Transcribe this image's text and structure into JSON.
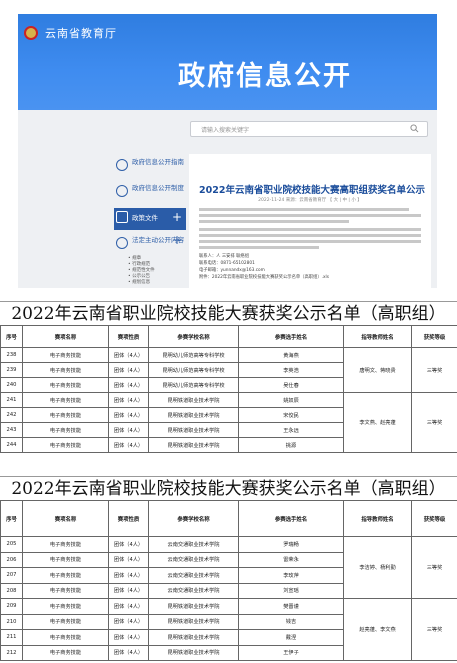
{
  "site": {
    "name": "云南省教育厅",
    "banner_title": "政府信息公开"
  },
  "search": {
    "placeholder": "请输入搜索关键字"
  },
  "sidebar": {
    "items": [
      {
        "label": "政府信息公开指南"
      },
      {
        "label": "政府信息公开制度"
      },
      {
        "label": "政策文件"
      },
      {
        "label": "法定主动公开内容"
      }
    ],
    "sub_items": [
      "• 规章",
      "• 行政规范",
      "• 规范性文件",
      "• 公示公告",
      "• 规划信息"
    ]
  },
  "article": {
    "title": "2022年云南省职业院校技能大赛高职组获奖名单公示",
    "meta": "2022-11-24  来源：云南省教育厅  【 大 | 中 | 小 】",
    "footer_lines": [
      "联系人：人 三安排 联络组",
      "联系电话：0871-65102801",
      "电子邮箱：yunnandx@163.com",
      "附件：2022年云南省职业院校技能大赛获奖公示名单（高职组）.xls"
    ]
  },
  "table1": {
    "title": "2022年云南省职业院校技能大赛获奖公示名单（高职组）",
    "headers": [
      "序号",
      "赛项名称",
      "赛项性质",
      "参赛学校名称",
      "参赛选手姓名",
      "指导教师姓名",
      "获奖等级"
    ],
    "rows": [
      {
        "no": "238",
        "event": "电子商务技能",
        "type": "团体（4人）",
        "school": "昆明幼儿师范高等专科学校",
        "name": "黄海燕"
      },
      {
        "no": "239",
        "event": "电子商务技能",
        "type": "团体（4人）",
        "school": "昆明幼儿师范高等专科学校",
        "name": "李英浩"
      },
      {
        "no": "240",
        "event": "电子商务技能",
        "type": "团体（4人）",
        "school": "昆明幼儿师范高等专科学校",
        "name": "吴仕春"
      },
      {
        "no": "241",
        "event": "电子商务技能",
        "type": "团体（4人）",
        "school": "昆明铁道职业技术学院",
        "name": "姚奴辰"
      },
      {
        "no": "242",
        "event": "电子商务技能",
        "type": "团体（4人）",
        "school": "昆明铁道职业技术学院",
        "name": "宋佼民"
      },
      {
        "no": "243",
        "event": "电子商务技能",
        "type": "团体（4人）",
        "school": "昆明铁道职业技术学院",
        "name": "王永远"
      },
      {
        "no": "244",
        "event": "电子商务技能",
        "type": "团体（4人）",
        "school": "昆明铁道职业技术学院",
        "name": "挑源"
      }
    ],
    "groups": [
      {
        "teacher": "唐明文、蒋晓贵",
        "award": "三等奖"
      },
      {
        "teacher": "李文燕、赵亮蓬",
        "award": "三等奖"
      }
    ]
  },
  "table2": {
    "title": "2022年云南省职业院校技能大赛获奖公示名单（高职组）",
    "headers": [
      "序号",
      "赛项名称",
      "赛项性质",
      "参赛学校名称",
      "参赛选手姓名",
      "指导教师姓名",
      "获奖等级"
    ],
    "rows": [
      {
        "no": "205",
        "event": "电子商务技能",
        "type": "团体（4人）",
        "school": "云南交通职业技术学院",
        "name": "罗瑞畅"
      },
      {
        "no": "206",
        "event": "电子商务技能",
        "type": "团体（4人）",
        "school": "云南交通职业技术学院",
        "name": "雷荣永"
      },
      {
        "no": "207",
        "event": "电子商务技能",
        "type": "团体（4人）",
        "school": "云南交通职业技术学院",
        "name": "李玫萍"
      },
      {
        "no": "208",
        "event": "电子商务技能",
        "type": "团体（4人）",
        "school": "云南交通职业技术学院",
        "name": "刘宣瑶"
      },
      {
        "no": "209",
        "event": "电子商务技能",
        "type": "团体（4人）",
        "school": "昆明铁道职业技术学院",
        "name": "樊晋谨"
      },
      {
        "no": "210",
        "event": "电子商务技能",
        "type": "团体（4人）",
        "school": "昆明铁道职业技术学院",
        "name": "钱吉"
      },
      {
        "no": "211",
        "event": "电子商务技能",
        "type": "团体（4人）",
        "school": "昆明铁道职业技术学院",
        "name": "戴涅"
      },
      {
        "no": "212",
        "event": "电子商务技能",
        "type": "团体（4人）",
        "school": "昆明铁道职业技术学院",
        "name": "王伊子"
      }
    ],
    "groups": [
      {
        "teacher": "李洁婷、杨利勤",
        "award": "三等奖"
      },
      {
        "teacher": "赵亮蓬、李文燕",
        "award": "三等奖"
      }
    ]
  }
}
